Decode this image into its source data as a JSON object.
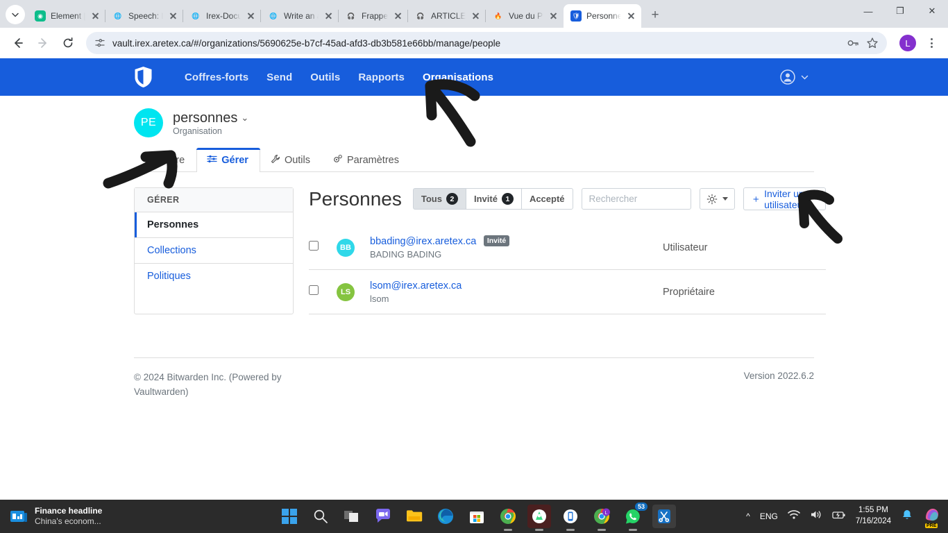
{
  "browser": {
    "tabs": [
      {
        "title": "Element | bra",
        "favicon": "element-icon",
        "color": "#0dbd8b",
        "active": false
      },
      {
        "title": "Speech: En ta",
        "favicon": "globe-icon",
        "color": "#9aa0a6",
        "active": false
      },
      {
        "title": "Irex-Docume",
        "favicon": "globe-icon",
        "color": "#9aa0a6",
        "active": false
      },
      {
        "title": "Write an arti",
        "favicon": "globe-icon",
        "color": "#9aa0a6",
        "active": false
      },
      {
        "title": "Frappe",
        "favicon": "headphones-icon",
        "color": "#ff8c00",
        "active": false
      },
      {
        "title": "ARTICLE: cré",
        "favicon": "headphones-icon",
        "color": "#222222",
        "active": false
      },
      {
        "title": "Vue du Planr",
        "favicon": "flame-icon",
        "color": "#ff8c00",
        "active": false
      },
      {
        "title": "Personnes | O",
        "favicon": "bitwarden-icon",
        "color": "#175ddc",
        "active": true
      }
    ],
    "new_tab_label": "+",
    "url": "vault.irex.aretex.ca/#/organizations/5690625e-b7cf-45ad-afd3-db3b581e66bb/manage/people",
    "profile_initial": "L",
    "window_controls": {
      "minimize": "—",
      "maximize": "❐",
      "close": "✕"
    }
  },
  "topnav": {
    "logo": "bitwarden-shield-icon",
    "items": [
      {
        "label": "Coffres-forts",
        "active": false
      },
      {
        "label": "Send",
        "active": false
      },
      {
        "label": "Outils",
        "active": false
      },
      {
        "label": "Rapports",
        "active": false
      },
      {
        "label": "Organisations",
        "active": true
      }
    ],
    "accent_color": "#175ddc"
  },
  "org": {
    "avatar_initials": "PE",
    "avatar_color": "#00e5f0",
    "name": "personnes",
    "subtitle": "Organisation"
  },
  "product_tabs": [
    {
      "label": "Coffre",
      "icon": "lock-icon",
      "active": false
    },
    {
      "label": "Gérer",
      "icon": "sliders-icon",
      "active": true
    },
    {
      "label": "Outils",
      "icon": "wrench-icon",
      "active": false
    },
    {
      "label": "Paramètres",
      "icon": "gears-icon",
      "active": false
    }
  ],
  "sidebar": {
    "heading": "GÉRER",
    "items": [
      {
        "label": "Personnes",
        "active": true
      },
      {
        "label": "Collections",
        "active": false
      },
      {
        "label": "Politiques",
        "active": false
      }
    ]
  },
  "main": {
    "title": "Personnes",
    "filters": [
      {
        "label": "Tous",
        "count": "2",
        "active": true
      },
      {
        "label": "Invité",
        "count": "1",
        "active": false
      },
      {
        "label": "Accepté",
        "count": "",
        "active": false
      }
    ],
    "search_placeholder": "Rechercher",
    "search_value": "",
    "gear_label": "gear-icon",
    "invite_label": "Inviter un utilisateur",
    "users": [
      {
        "email": "bbading@irex.aretex.ca",
        "name": "BADING BADING",
        "initials": "BB",
        "avatar_color": "#2fd8e9",
        "badge": "Invité",
        "role": "Utilisateur",
        "checked": false
      },
      {
        "email": "lsom@irex.aretex.ca",
        "name": "lsom",
        "initials": "LS",
        "avatar_color": "#85c440",
        "badge": "",
        "role": "Propriétaire",
        "checked": false
      }
    ]
  },
  "footer": {
    "copyright": "© 2024 Bitwarden Inc. (Powered by Vaultwarden)",
    "version": "Version 2022.6.2"
  },
  "taskbar": {
    "news_title": "Finance headline",
    "news_sub": "China's econom...",
    "icons": [
      {
        "name": "start-icon"
      },
      {
        "name": "search-icon"
      },
      {
        "name": "task-view-icon"
      },
      {
        "name": "chat-icon"
      },
      {
        "name": "file-explorer-icon"
      },
      {
        "name": "edge-icon"
      },
      {
        "name": "microsoft-store-icon"
      },
      {
        "name": "chrome-icon"
      },
      {
        "name": "android-studio-icon"
      },
      {
        "name": "phone-link-icon"
      },
      {
        "name": "chrome-profile-icon"
      },
      {
        "name": "whatsapp-icon",
        "badge": "53"
      },
      {
        "name": "snipping-tool-icon"
      }
    ],
    "chevron": "^",
    "language": "ENG",
    "time": "1:55 PM",
    "date": "7/16/2024",
    "copilot": "copilot-icon",
    "copilot_tag": "PRE"
  }
}
